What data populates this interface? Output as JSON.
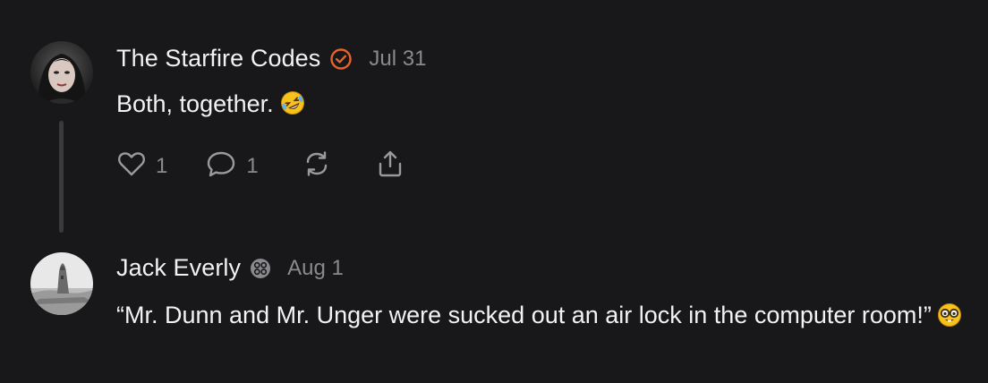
{
  "posts": [
    {
      "author": "The Starfire Codes",
      "date": "Jul 31",
      "text": "Both, together.",
      "emoji": "rolling-on-floor-laughing-emoji",
      "likes": "1",
      "replies": "1"
    },
    {
      "author": "Jack Everly",
      "date": "Aug 1",
      "text": "“Mr. Dunn and Mr. Unger were sucked out an air lock in the computer room!”",
      "emoji": "nerd-face-emoji"
    }
  ],
  "colors": {
    "background": "#18181a",
    "verified_badge": "#e8632a",
    "muted": "#8a8a8e"
  }
}
